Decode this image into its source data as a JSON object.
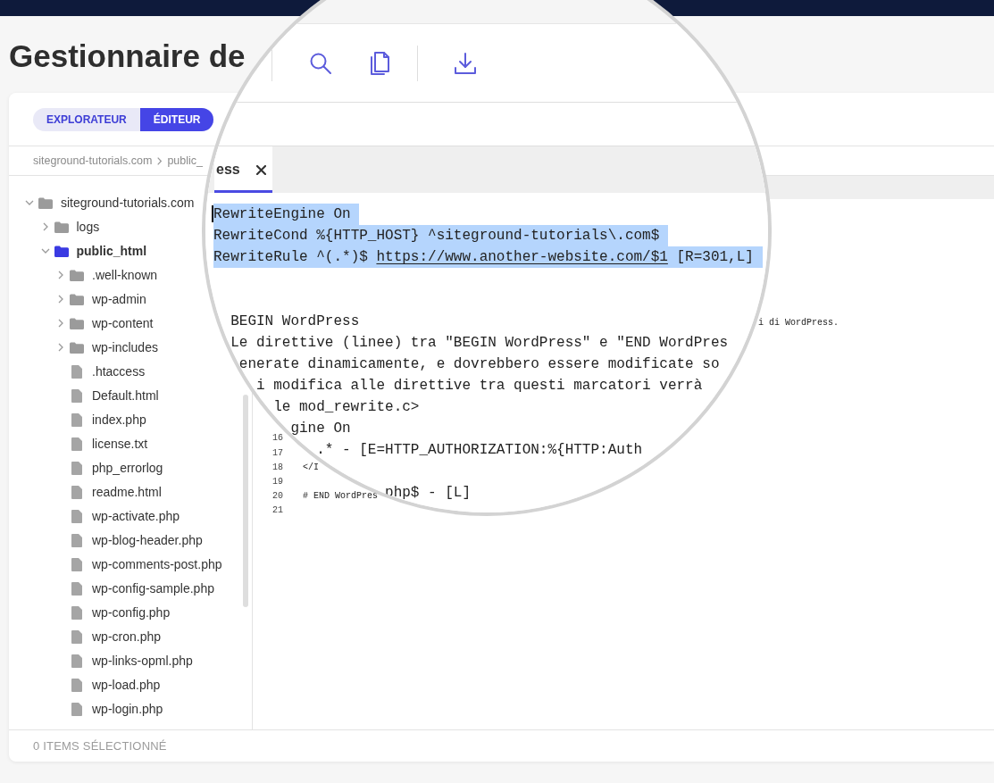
{
  "page_title": "Gestionnaire de",
  "view_tabs": [
    {
      "label": "EXPLORATEUR",
      "selected": false
    },
    {
      "label": "ÉDITEUR",
      "selected": true
    }
  ],
  "breadcrumb": [
    "siteground-tutorials.com",
    "public_"
  ],
  "file_tree": [
    {
      "name": "siteground-tutorials.com",
      "kind": "folder",
      "expanded": true,
      "selected": false,
      "children": [
        {
          "name": "logs",
          "kind": "folder",
          "expanded": false,
          "selected": false
        },
        {
          "name": "public_html",
          "kind": "folder",
          "expanded": true,
          "selected": true,
          "children": [
            {
              "name": ".well-known",
              "kind": "folder",
              "expanded": false,
              "selected": false
            },
            {
              "name": "wp-admin",
              "kind": "folder",
              "expanded": false,
              "selected": false
            },
            {
              "name": "wp-content",
              "kind": "folder",
              "expanded": false,
              "selected": false
            },
            {
              "name": "wp-includes",
              "kind": "folder",
              "expanded": false,
              "selected": false
            },
            {
              "name": ".htaccess",
              "kind": "file",
              "selected": false
            },
            {
              "name": "Default.html",
              "kind": "file",
              "selected": false
            },
            {
              "name": "index.php",
              "kind": "file",
              "selected": false
            },
            {
              "name": "license.txt",
              "kind": "file",
              "selected": false
            },
            {
              "name": "php_errorlog",
              "kind": "file",
              "selected": false
            },
            {
              "name": "readme.html",
              "kind": "file",
              "selected": false
            },
            {
              "name": "wp-activate.php",
              "kind": "file",
              "selected": false
            },
            {
              "name": "wp-blog-header.php",
              "kind": "file",
              "selected": false
            },
            {
              "name": "wp-comments-post.php",
              "kind": "file",
              "selected": false
            },
            {
              "name": "wp-config-sample.php",
              "kind": "file",
              "selected": false
            },
            {
              "name": "wp-config.php",
              "kind": "file",
              "selected": false
            },
            {
              "name": "wp-cron.php",
              "kind": "file",
              "selected": false
            },
            {
              "name": "wp-links-opml.php",
              "kind": "file",
              "selected": false
            },
            {
              "name": "wp-load.php",
              "kind": "file",
              "selected": false
            },
            {
              "name": "wp-login.php",
              "kind": "file",
              "selected": false
            }
          ]
        }
      ]
    }
  ],
  "editor": {
    "lines": [
      {
        "text": "i di WordPress."
      },
      {
        "number": "16"
      },
      {
        "number": "17"
      },
      {
        "number": "18",
        "text": "</I"
      },
      {
        "number": "19"
      },
      {
        "number": "20",
        "text": "# END WordPres"
      },
      {
        "number": "21"
      }
    ]
  },
  "magnifier": {
    "file_tab": {
      "label": "ess",
      "selected": true
    },
    "code_lines": [
      {
        "text": "RewriteEngine On",
        "selected": true,
        "caret": true
      },
      {
        "text": "RewriteCond %{HTTP_HOST} ^siteground-tutorials\\.com$",
        "selected": true,
        "caret": false
      },
      {
        "parts": [
          {
            "text": "RewriteRule ^(.*)$ ",
            "kind": "code"
          },
          {
            "text": "https://www.another-website.com/$1",
            "kind": "link"
          },
          {
            "text": " [R=301,L]",
            "kind": "code"
          }
        ],
        "selected": true,
        "caret": false
      },
      {
        "text": "BEGIN WordPress",
        "selected": false,
        "caret": false
      },
      {
        "text": "Le direttive (linee) tra \"BEGIN WordPress\" e \"END WordPres",
        "selected": false,
        "caret": false
      },
      {
        "text": "enerate dinamicamente, e dovrebbero essere modificate so",
        "selected": false,
        "caret": false
      },
      {
        "text": "i modifica alle direttive tra questi marcatori verrà",
        "selected": false,
        "caret": false
      },
      {
        "text": "le mod_rewrite.c>",
        "selected": false,
        "caret": false
      },
      {
        "text": "gine On",
        "selected": false,
        "caret": false
      },
      {
        "text": ".* - [E=HTTP_AUTHORIZATION:%{HTTP:Auth",
        "selected": false,
        "caret": false
      },
      {
        "text": "php$ - [L]",
        "selected": false,
        "caret": false
      }
    ]
  },
  "status_bar": {
    "text": "0 ITEMS SÉLECTIONNÉ"
  }
}
